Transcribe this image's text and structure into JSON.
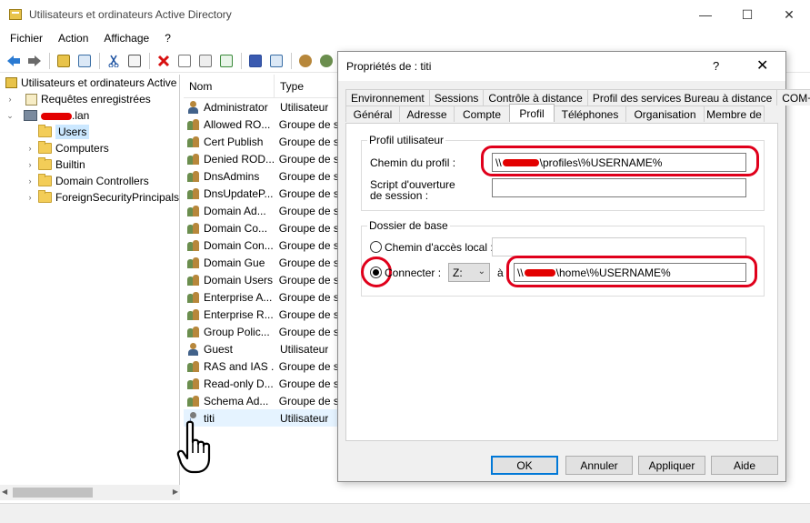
{
  "window": {
    "title": "Utilisateurs et ordinateurs Active Directory",
    "minimize": "—",
    "maximize": "☐",
    "close": "✕"
  },
  "menu": [
    "Fichier",
    "Action",
    "Affichage",
    "?"
  ],
  "tree": {
    "root": "Utilisateurs et ordinateurs Active",
    "saved_queries": "Requêtes enregistrées",
    "domain_suffix": ".lan",
    "items": [
      "Users",
      "Computers",
      "Builtin",
      "Domain Controllers",
      "ForeignSecurityPrincipals"
    ]
  },
  "list": {
    "columns": [
      "Nom",
      "Type"
    ],
    "rows": [
      {
        "name": "Administrator",
        "type": "Utilisateur",
        "icon": "user"
      },
      {
        "name": "Allowed RO...",
        "type": "Groupe de s",
        "icon": "group"
      },
      {
        "name": "Cert Publish",
        "type": "Groupe de s",
        "icon": "group"
      },
      {
        "name": "Denied ROD...",
        "type": "Groupe de s",
        "icon": "group"
      },
      {
        "name": "DnsAdmins",
        "type": "Groupe de s",
        "icon": "group"
      },
      {
        "name": "DnsUpdateP...",
        "type": "Groupe de s",
        "icon": "group"
      },
      {
        "name": "Domain Ad...",
        "type": "Groupe de s",
        "icon": "group"
      },
      {
        "name": "Domain Co...",
        "type": "Groupe de s",
        "icon": "group"
      },
      {
        "name": "Domain Con...",
        "type": "Groupe de s",
        "icon": "group"
      },
      {
        "name": "Domain Gue",
        "type": "Groupe de s",
        "icon": "group"
      },
      {
        "name": "Domain Users",
        "type": "Groupe de s",
        "icon": "group"
      },
      {
        "name": "Enterprise A...",
        "type": "Groupe de s",
        "icon": "group"
      },
      {
        "name": "Enterprise R...",
        "type": "Groupe de s",
        "icon": "group"
      },
      {
        "name": "Group Polic...",
        "type": "Groupe de s",
        "icon": "group"
      },
      {
        "name": "Guest",
        "type": "Utilisateur",
        "icon": "user"
      },
      {
        "name": "RAS and IAS ...",
        "type": "Groupe de s",
        "icon": "group"
      },
      {
        "name": "Read-only D...",
        "type": "Groupe de s",
        "icon": "group"
      },
      {
        "name": "Schema Ad...",
        "type": "Groupe de s",
        "icon": "group"
      },
      {
        "name": "titi",
        "type": "Utilisateur",
        "icon": "user-disabled"
      }
    ]
  },
  "dialog": {
    "title": "Propriétés de : titi",
    "help": "?",
    "close": "✕",
    "tabs_top": [
      "Environnement",
      "Sessions",
      "Contrôle à distance",
      "Profil des services Bureau à distance",
      "COM+"
    ],
    "tabs_bottom": [
      "Général",
      "Adresse",
      "Compte",
      "Profil",
      "Téléphones",
      "Organisation",
      "Membre de"
    ],
    "active_tab": "Profil",
    "profile_group": "Profil utilisateur",
    "profile_path_label": "Chemin du profil :",
    "profile_path_prefix": "\\\\",
    "profile_path_suffix": "\\profiles\\%USERNAME%",
    "logon_script_label": "Script d'ouverture de session :",
    "logon_script_value": "",
    "home_group": "Dossier de base",
    "local_path_label": "Chemin d'accès local :",
    "local_path_value": "",
    "connect_label": "Connecter :",
    "drive_letter": "Z:",
    "to_label": "à",
    "home_path_prefix": "\\\\",
    "home_path_suffix": "\\home\\%USERNAME%",
    "buttons": {
      "ok": "OK",
      "cancel": "Annuler",
      "apply": "Appliquer",
      "help": "Aide"
    }
  },
  "colors": {
    "highlight": "#e0001b",
    "selection": "#cce8ff",
    "accent": "#0078d7"
  }
}
